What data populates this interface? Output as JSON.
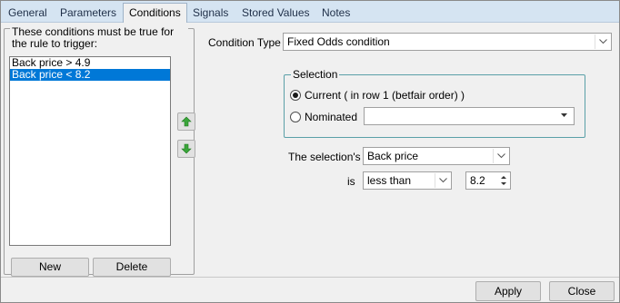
{
  "tabs": [
    {
      "label": "General"
    },
    {
      "label": "Parameters"
    },
    {
      "label": "Conditions"
    },
    {
      "label": "Signals"
    },
    {
      "label": "Stored Values"
    },
    {
      "label": "Notes"
    }
  ],
  "active_tab": "Conditions",
  "conditions_panel": {
    "legend": "These conditions must be true for the rule to trigger:",
    "items": [
      {
        "label": "Back price > 4.9",
        "selected": false
      },
      {
        "label": "Back price < 8.2",
        "selected": true
      }
    ],
    "new_label": "New",
    "delete_label": "Delete",
    "move_up_icon": "green-up-arrow-icon",
    "move_down_icon": "green-down-arrow-icon"
  },
  "condition_type": {
    "label": "Condition Type",
    "value": "Fixed Odds condition"
  },
  "selection": {
    "legend": "Selection",
    "current_label": "Current ( in row 1 (betfair order) )",
    "current_checked": true,
    "nominated_label": "Nominated",
    "nominated_checked": false,
    "nominated_value": ""
  },
  "criteria": {
    "selection_label": "The selection's",
    "field_value": "Back price",
    "is_label": "is",
    "operator_value": "less than",
    "amount_value": "8.2"
  },
  "footer": {
    "apply_label": "Apply",
    "close_label": "Close"
  },
  "colors": {
    "tab_strip": "#d5e4f2",
    "selection_highlight": "#0078d7",
    "arrow_green": "#3aa53a",
    "selection_border": "#5aa0a8"
  }
}
